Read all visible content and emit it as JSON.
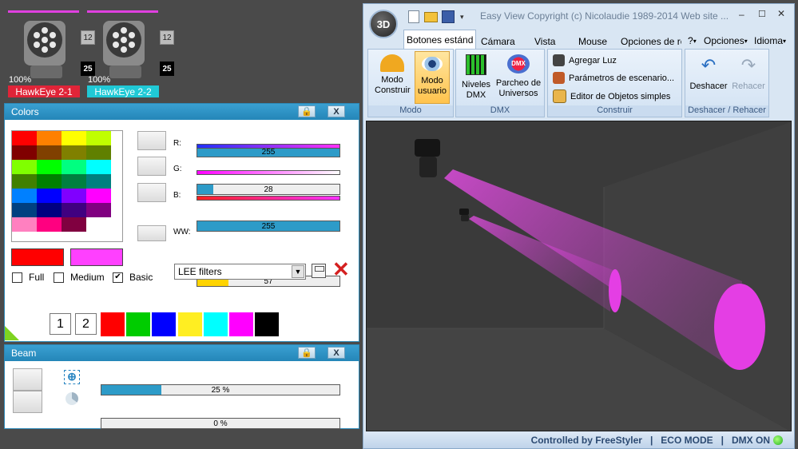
{
  "fixtures": [
    {
      "label": "HawkEye 2-1",
      "pct": "100%",
      "ch_start": "12",
      "ch_count": "25",
      "color": "#e02438"
    },
    {
      "label": "HawkEye 2-2",
      "pct": "100%",
      "ch_start": "12",
      "ch_count": "25",
      "color": "#20c9d6"
    }
  ],
  "colors_panel": {
    "title": "Colors",
    "grid": [
      [
        "#ff0000",
        "#ff8000",
        "#ffff00",
        "#c0ff00"
      ],
      [
        "#800000",
        "#804000",
        "#808000",
        "#608000"
      ],
      [
        "#80ff00",
        "#00ff00",
        "#00ff80",
        "#00ffff"
      ],
      [
        "#408000",
        "#008000",
        "#008040",
        "#008080"
      ],
      [
        "#0080ff",
        "#0000ff",
        "#8000ff",
        "#ff00ff"
      ],
      [
        "#004080",
        "#000080",
        "#400080",
        "#800080"
      ],
      [
        "#ff80c0",
        "#ff0080",
        "#800040",
        "#ffffff"
      ]
    ],
    "sliders": [
      {
        "label": "R:",
        "value": "255",
        "fraction": 1.0,
        "grad": "linear-gradient(90deg,#2030ff,#ff30ff)"
      },
      {
        "label": "G:",
        "value": "28",
        "fraction": 0.11,
        "grad": "linear-gradient(90deg,#ff00ff,#ffffff)"
      },
      {
        "label": "B:",
        "value": "255",
        "fraction": 1.0,
        "grad": "linear-gradient(90deg,#ff2020,#ff30ff)"
      }
    ],
    "ww": {
      "label": "WW:",
      "value": "57",
      "fraction": 0.22
    },
    "preview_colors": [
      "#ff0000",
      "#ff40ff"
    ],
    "checkboxes": [
      {
        "label": "Full",
        "checked": false
      },
      {
        "label": "Medium",
        "checked": false
      },
      {
        "label": "Basic",
        "checked": true
      }
    ],
    "filter_select": "LEE filters",
    "presets": [
      "1",
      "2"
    ],
    "quick_colors": [
      "#ff0000",
      "#00cc00",
      "#0000ff",
      "#ffee22",
      "#00ffff",
      "#ff00ff",
      "#000000"
    ]
  },
  "beam_panel": {
    "title": "Beam",
    "zoom": {
      "value": "25 %",
      "fraction": 0.25
    },
    "frost": {
      "value": "0 %",
      "fraction": 0.0
    }
  },
  "app": {
    "title": "Easy View  Copyright (c) Nicolaudie 1989-2014  Web site ...",
    "logo": "3D",
    "tabs": [
      "Botones estánd",
      "Cámara",
      "Vista",
      "Mouse",
      "Opciones de re"
    ],
    "right_menu": [
      "?",
      "Opciones",
      "Idioma"
    ],
    "groups": {
      "modo": {
        "label": "Modo",
        "buttons": [
          "Modo Construir",
          "Modo usuario"
        ]
      },
      "dmx": {
        "label": "DMX",
        "buttons": [
          "Niveles DMX",
          "Parcheo de Universos"
        ],
        "icon_text": "DMX"
      },
      "construir": {
        "label": "Construir",
        "items": [
          "Agregar Luz",
          "Parámetros de escenario...",
          "Editor de Objetos simples"
        ]
      },
      "undo": {
        "label": "Deshacer / Rehacer",
        "buttons": [
          "Deshacer",
          "Rehacer"
        ]
      }
    },
    "status": [
      "Controlled by FreeStyler",
      "|",
      "ECO MODE",
      "|",
      "DMX ON"
    ]
  }
}
